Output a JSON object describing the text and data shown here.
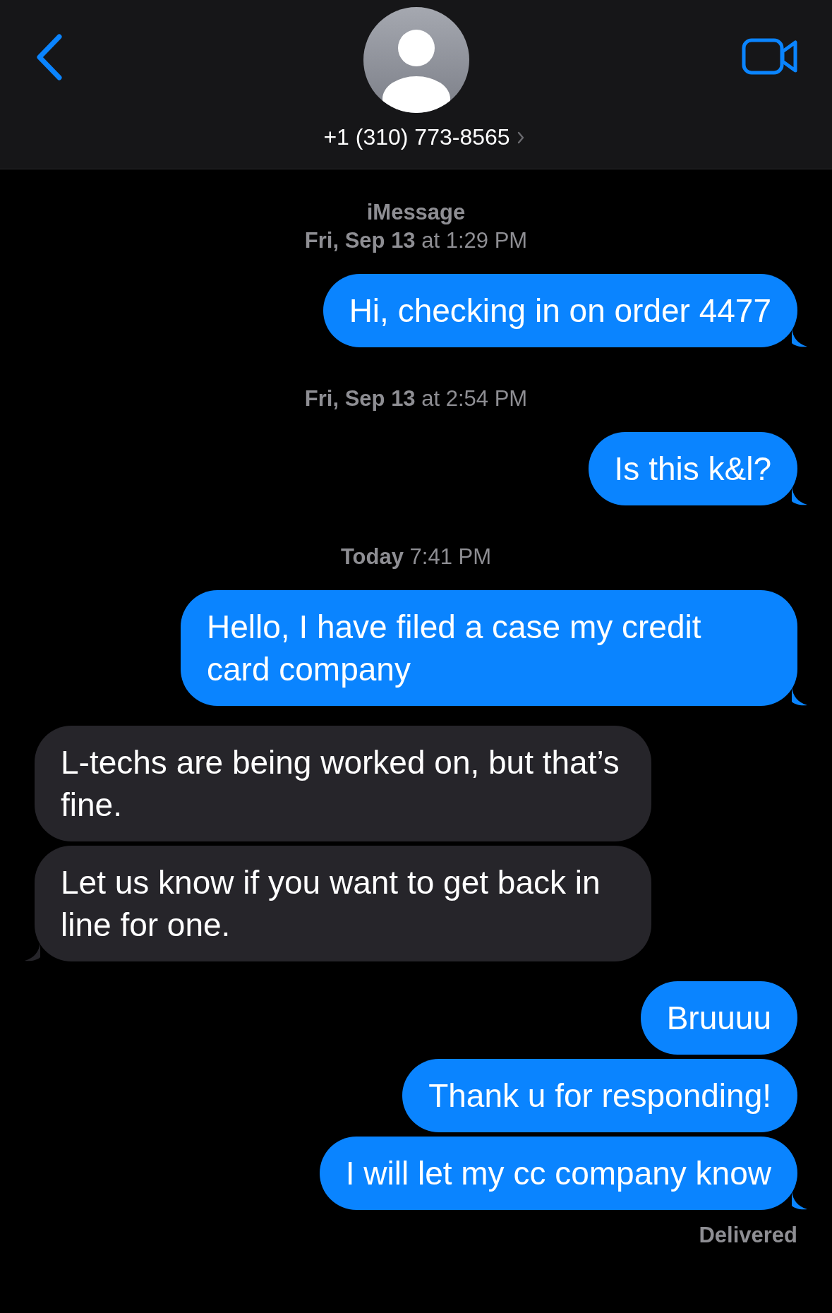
{
  "header": {
    "contact": "+1 (310) 773-8565"
  },
  "conversation": [
    {
      "kind": "timestamp",
      "service": "iMessage",
      "text": "**Fri, Sep 13** at 1:29 PM"
    },
    {
      "kind": "sent",
      "text": "Hi, checking in on order 4477",
      "tail": true
    },
    {
      "kind": "timestamp",
      "text": "**Fri, Sep 13** at 2:54 PM"
    },
    {
      "kind": "sent",
      "text": "Is this k&l?",
      "tail": true
    },
    {
      "kind": "timestamp",
      "text": "**Today** 7:41 PM"
    },
    {
      "kind": "sent",
      "text": "Hello, I have filed a case my credit card company",
      "tail": true
    },
    {
      "kind": "received",
      "text": "L-techs are being worked on, but that’s fine.",
      "tail": false
    },
    {
      "kind": "received",
      "text": "Let us know if you want to get back in line for one.",
      "tail": true
    },
    {
      "kind": "sent",
      "text": "Bruuuu",
      "tail": false
    },
    {
      "kind": "sent",
      "text": "Thank u for responding!",
      "tail": false
    },
    {
      "kind": "sent",
      "text": "I will let my cc company know",
      "tail": true
    }
  ],
  "status": "Delivered"
}
